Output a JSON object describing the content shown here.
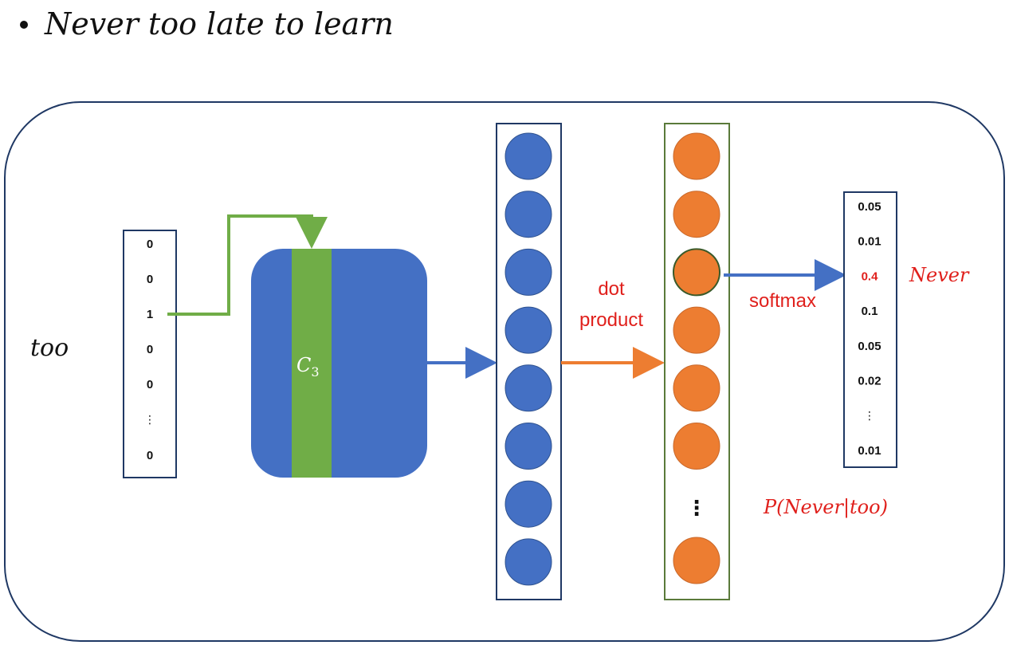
{
  "title": "Never too late to learn",
  "input_word": "too",
  "one_hot_vector": [
    "0",
    "0",
    "1",
    "0",
    "0",
    "⋮",
    "0"
  ],
  "embedding_matrix": {
    "label": "C",
    "subscript": "3"
  },
  "hidden_layer": {
    "visible_nodes": 8
  },
  "output_layer": {
    "visible_nodes": 7,
    "ellipsis": "⋮"
  },
  "operations": {
    "dot_product_line1": "dot",
    "dot_product_line2": "product",
    "softmax": "softmax"
  },
  "probabilities": [
    "0.05",
    "0.01",
    "0.4",
    "0.1",
    "0.05",
    "0.02",
    "⋮",
    "0.01"
  ],
  "highlighted_index": 2,
  "predicted_word": "Never",
  "conditional_probability": "P(Never|too)",
  "colors": {
    "blue": "#4470c4",
    "green": "#70ad47",
    "orange": "#ed7d31",
    "red": "#e0201c",
    "frame": "#1f3864"
  }
}
